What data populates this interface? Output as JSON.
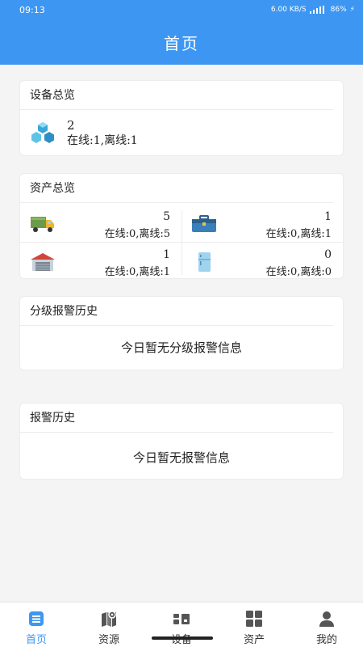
{
  "status_bar": {
    "time": "09:13",
    "net_speed": "6.00 KB/S",
    "battery": "86%"
  },
  "header": {
    "title": "首页"
  },
  "device_overview": {
    "title": "设备总览",
    "count": "2",
    "status": "在线:1,离线:1"
  },
  "asset_overview": {
    "title": "资产总览",
    "items": [
      {
        "icon": "truck-icon",
        "value": "5",
        "status": "在线:0,离线:5"
      },
      {
        "icon": "toolbox-icon",
        "value": "1",
        "status": "在线:0,离线:1"
      },
      {
        "icon": "warehouse-icon",
        "value": "1",
        "status": "在线:0,离线:1"
      },
      {
        "icon": "fridge-icon",
        "value": "0",
        "status": "在线:0,离线:0"
      }
    ]
  },
  "grade_alarm": {
    "title": "分级报警历史",
    "empty_text": "今日暂无分级报警信息"
  },
  "alarm_history": {
    "title": "报警历史",
    "empty_text": "今日暂无报警信息"
  },
  "tabbar": {
    "active_color": "#3d97f2",
    "items": [
      {
        "label": "首页",
        "icon": "home-icon"
      },
      {
        "label": "资源",
        "icon": "map-icon"
      },
      {
        "label": "设备",
        "icon": "device-icon"
      },
      {
        "label": "资产",
        "icon": "grid-icon"
      },
      {
        "label": "我的",
        "icon": "user-icon"
      }
    ]
  }
}
